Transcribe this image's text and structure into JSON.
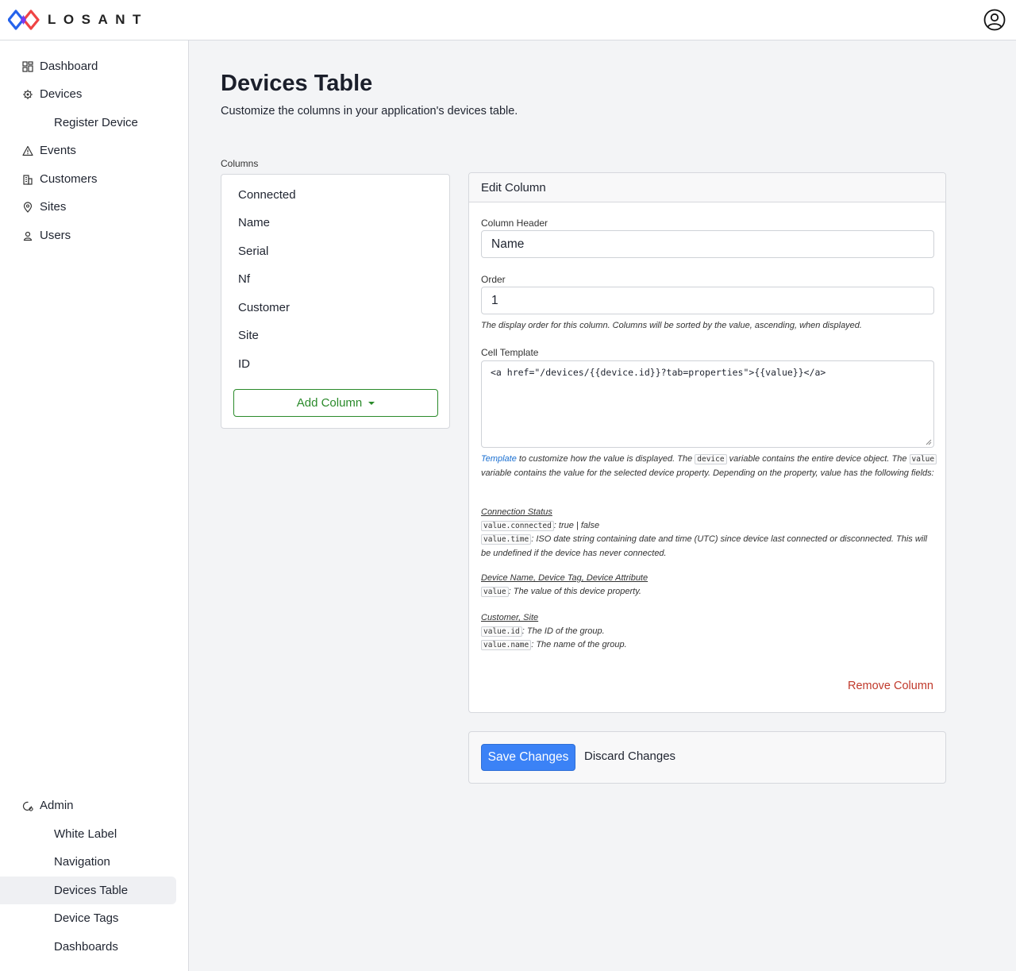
{
  "app": {
    "brand": "LOSANT"
  },
  "sidebar": {
    "items": [
      {
        "label": "Dashboard",
        "icon": "grid-icon"
      },
      {
        "label": "Devices",
        "icon": "chip-icon"
      },
      {
        "label": "Register Device"
      },
      {
        "label": "Events",
        "icon": "warning-icon"
      },
      {
        "label": "Customers",
        "icon": "building-icon"
      },
      {
        "label": "Sites",
        "icon": "map-pin-icon"
      },
      {
        "label": "Users",
        "icon": "user-icon"
      }
    ],
    "admin": {
      "label": "Admin",
      "icon": "admin-gear-icon",
      "items": [
        {
          "label": "White Label"
        },
        {
          "label": "Navigation"
        },
        {
          "label": "Devices Table"
        },
        {
          "label": "Device Tags"
        },
        {
          "label": "Dashboards"
        }
      ]
    }
  },
  "page": {
    "title": "Devices Table",
    "subtitle": "Customize the columns in your application's devices table."
  },
  "columns": {
    "label": "Columns",
    "items": [
      "Connected",
      "Name",
      "Serial",
      "Nf",
      "Customer",
      "Site",
      "ID"
    ],
    "add_label": "Add Column"
  },
  "edit": {
    "title": "Edit Column",
    "header_label": "Column Header",
    "header_value": "Name",
    "order_label": "Order",
    "order_value": "1",
    "order_help": "The display order for this column. Columns will be sorted by the value, ascending, when displayed.",
    "template_label": "Cell Template",
    "template_value": "<a href=\"/devices/{{device.id}}?tab=properties\">{{value}}</a>",
    "help": {
      "link": "Template",
      "t1": " to customize how the value is displayed. The ",
      "code_device": "device",
      "t2": " variable contains the entire device object. The ",
      "code_value": "value",
      "t3": " variable contains the value for the selected device property. Depending on the property, value has the following fields:",
      "conn_heading": "Connection Status",
      "conn_code1": "value.connected",
      "conn_text1": ": true | false",
      "conn_code2": "value.time",
      "conn_text2": ": ISO date string containing date and time (UTC) since device last connected or disconnected. This will be undefined if the device has never connected.",
      "name_heading": "Device Name, Device Tag, Device Attribute",
      "name_code": "value",
      "name_text": ": The value of this device property.",
      "cust_heading": "Customer, Site",
      "cust_code1": "value.id",
      "cust_text1": ": The ID of the group.",
      "cust_code2": "value.name",
      "cust_text2": ": The name of the group."
    },
    "remove_label": "Remove Column"
  },
  "actions": {
    "save_label": "Save Changes",
    "discard_label": "Discard Changes"
  },
  "colors": {
    "primary": "#3b82f6",
    "success": "#2a8a2a",
    "danger": "#c0392b",
    "link": "#1a6fd1"
  }
}
